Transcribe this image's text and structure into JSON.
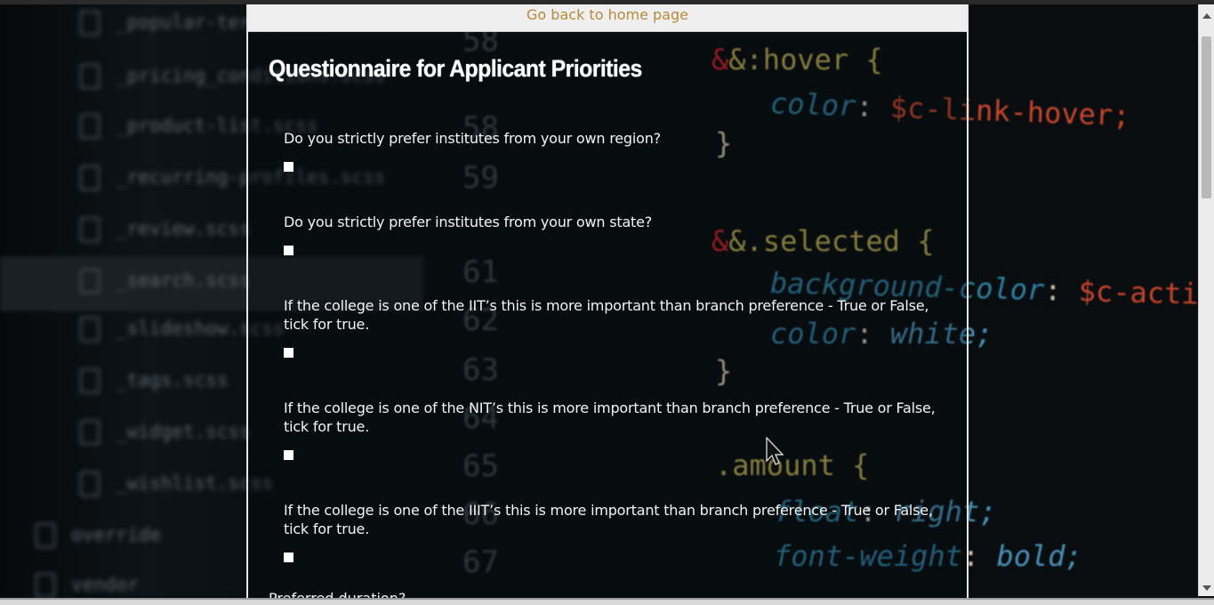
{
  "header": {
    "home_link": "Go back to home page"
  },
  "page": {
    "title": "Questionnaire for Applicant Priorities"
  },
  "questions": [
    {
      "text": "Do you strictly prefer institutes from your own region?",
      "checked": false
    },
    {
      "text": "Do you strictly prefer institutes from your own state?",
      "checked": false
    },
    {
      "text": "If the college is one of the IIT’s this is more important than branch preference - True or False, tick for true.",
      "checked": false
    },
    {
      "text": "If the college is one of the NIT’s this is more important than branch preference - True or False, tick for true.",
      "checked": false
    },
    {
      "text": "If the college is one of the IIIT’s this is more important than branch preference - True or False, tick for true.",
      "checked": false
    }
  ],
  "next_label": "Preferred duration?",
  "background": {
    "files": [
      "_popular-terms.scss",
      "_pricing_conditions.scss",
      "_product-list.scss",
      "_recurring-profiles.scss",
      "_review.scss",
      "_search.scss",
      "_slideshow.scss",
      "_tags.scss",
      "_widget.scss",
      "_wishlist.scss",
      "override",
      "vendor"
    ],
    "line_numbers": [
      "58",
      "59",
      "61",
      "62",
      "63",
      "64",
      "65",
      "66",
      "67"
    ],
    "code": {
      "hover": "&:hover {",
      "color_prop": "color",
      "hover_val": "$c-link-hover;",
      "close1": "}",
      "selected": "&.selected {",
      "bgcolor_prop": "background-color",
      "action_val": "$c-action;",
      "color_prop2": "color",
      "white_val": "white;",
      "close2": "}",
      "amount": ".amount {",
      "float_prop": "float",
      "float_val": "right;",
      "weight_prop": "font-weight",
      "weight_val": "bold;"
    }
  },
  "colors": {
    "link": "#b8893a",
    "panel_border": "#e6e6e6",
    "text": "#f4f4f4"
  }
}
